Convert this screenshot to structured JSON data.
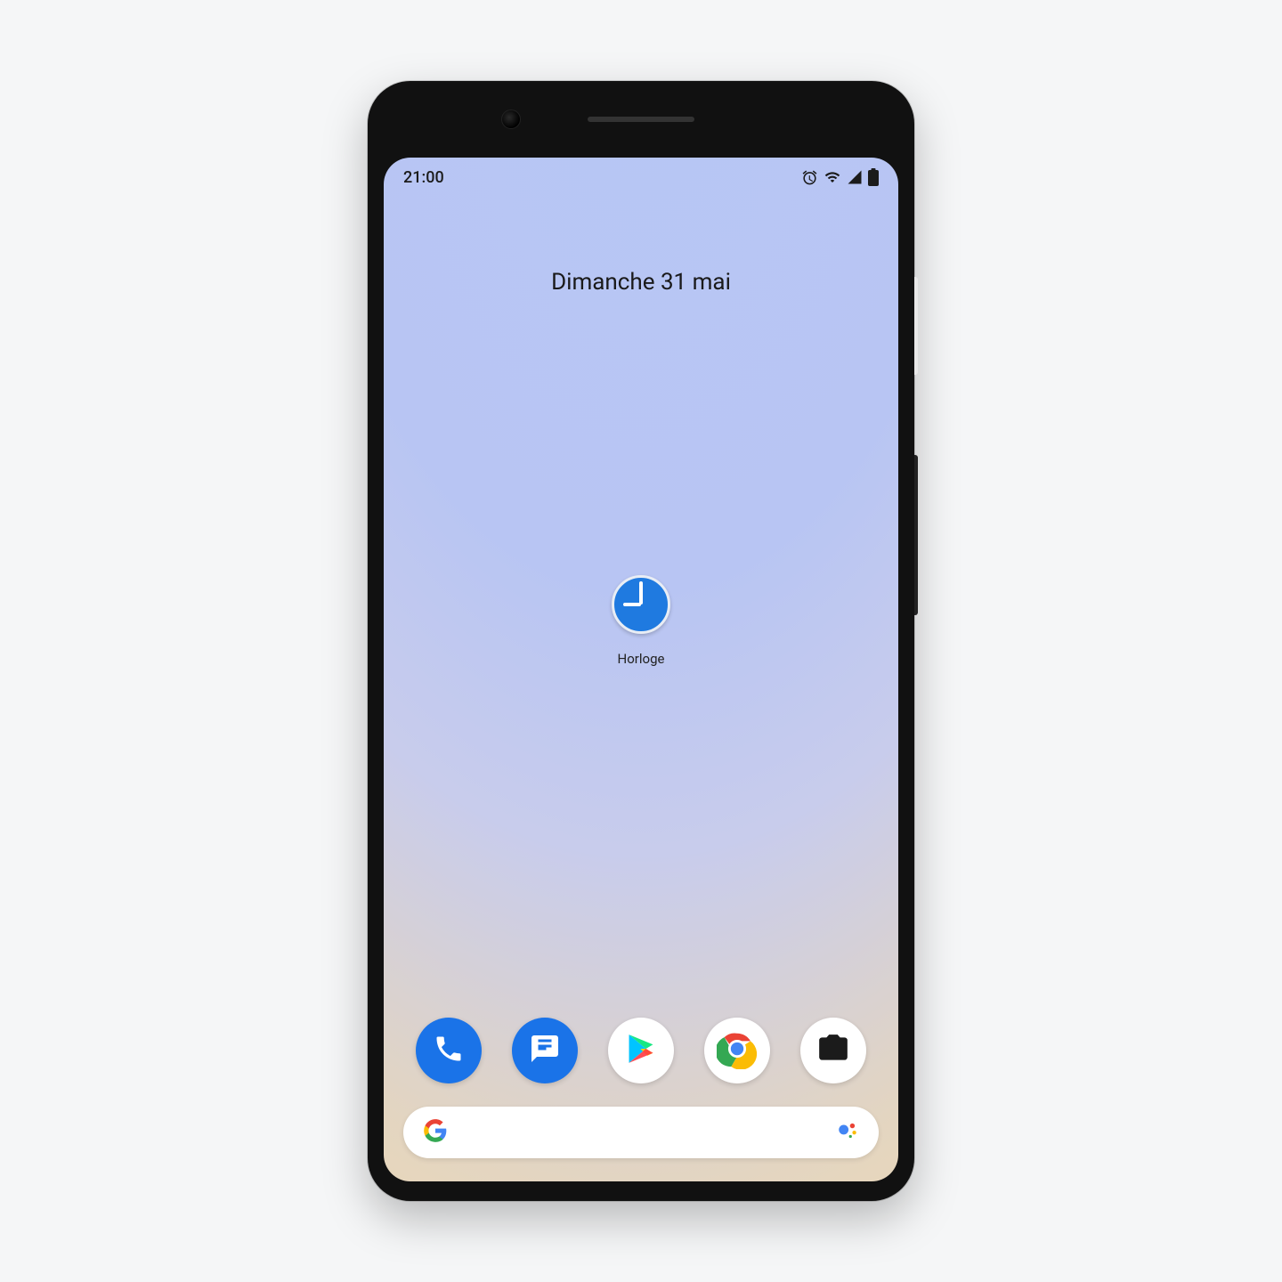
{
  "status_bar": {
    "time": "21:00",
    "icons": [
      "alarm",
      "wifi",
      "signal",
      "battery"
    ]
  },
  "date_widget": {
    "text": "Dimanche 31 mai"
  },
  "home_app": {
    "name": "Horloge"
  },
  "dock": {
    "apps": [
      "phone",
      "messages",
      "play-store",
      "chrome",
      "camera"
    ]
  },
  "colors": {
    "accent_blue": "#1a73e8",
    "google_blue": "#4285F4",
    "google_red": "#EA4335",
    "google_yellow": "#FBBC05",
    "google_green": "#34A853"
  }
}
